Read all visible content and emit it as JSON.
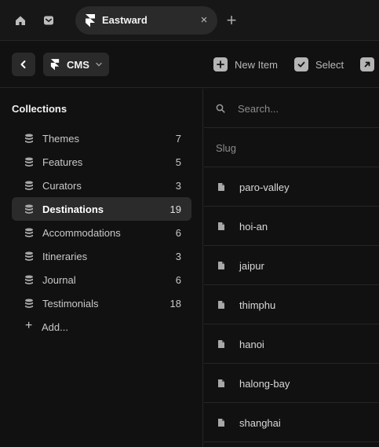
{
  "tab": {
    "title": "Eastward",
    "close_glyph": "×",
    "new_tab_glyph": "+",
    "icons": [
      "home-icon",
      "inbox-icon",
      "framer-logo-icon"
    ]
  },
  "toolbar": {
    "section_label": "CMS",
    "new_item_label": "New Item",
    "select_label": "Select",
    "icons": [
      "back-chevron-icon",
      "chevron-down-icon",
      "plus-icon",
      "check-icon",
      "external-arrow-icon"
    ]
  },
  "sidebar": {
    "heading": "Collections",
    "items": [
      {
        "label": "Themes",
        "count": "7"
      },
      {
        "label": "Features",
        "count": "5"
      },
      {
        "label": "Curators",
        "count": "3"
      },
      {
        "label": "Destinations",
        "count": "19"
      },
      {
        "label": "Accommodations",
        "count": "6"
      },
      {
        "label": "Itineraries",
        "count": "3"
      },
      {
        "label": "Journal",
        "count": "6"
      },
      {
        "label": "Testimonials",
        "count": "18"
      }
    ],
    "active": "Destinations",
    "add_label": "Add...",
    "add_glyph": "+"
  },
  "main": {
    "search_placeholder": "Search...",
    "column_header": "Slug",
    "rows": [
      "paro-valley",
      "hoi-an",
      "jaipur",
      "thimphu",
      "hanoi",
      "halong-bay",
      "shanghai"
    ]
  },
  "colors": {
    "background": "#111111",
    "panel": "#171717",
    "control": "#2a2a2a",
    "text": "#e6e6e6",
    "muted": "#8c8c8c",
    "divider": "#262626"
  }
}
